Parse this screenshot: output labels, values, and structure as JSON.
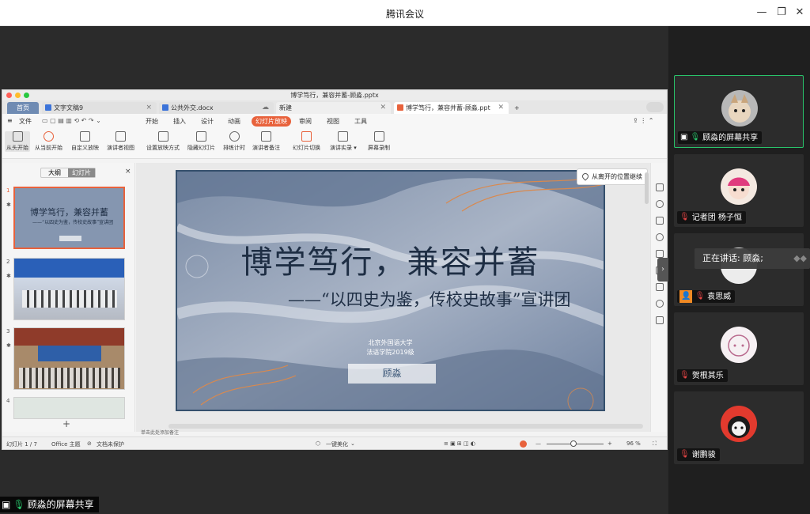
{
  "app": {
    "title": "腾讯会议"
  },
  "shared_window": {
    "doc_title": "博学笃行，兼容并蓄-顾淼.pptx",
    "tabs": [
      {
        "label": "首页"
      },
      {
        "label": "文字文稿9"
      },
      {
        "label": "公共外交.docx"
      },
      {
        "label": "新建"
      },
      {
        "label": "博学笃行，兼容并蓄-顾淼.ppt"
      }
    ],
    "menu": {
      "file": "文件",
      "items": [
        "开始",
        "插入",
        "设计",
        "动画",
        "幻灯片放映",
        "审阅",
        "视图",
        "工具"
      ]
    },
    "ribbon": [
      "从头开始",
      "从当前开始",
      "自定义放映",
      "演讲者视图",
      "设置放映方式",
      "隐藏幻灯片",
      "排练计时",
      "演讲者备注",
      "幻灯片切换",
      "演讲实录",
      "屏幕录制"
    ],
    "outline_tabs": [
      "大纲",
      "幻灯片"
    ],
    "thumb_numbers": [
      "1",
      "2",
      "3",
      "4"
    ],
    "thumb1": {
      "title": "博学笃行，兼容并蓄",
      "subtitle": "——“以四史为鉴，传校史故事”宣讲团"
    },
    "add_slide": "+",
    "slide": {
      "title": "博学笃行，兼容并蓄",
      "subtitle": "——“以四史为鉴，传校史故事”宣讲团",
      "org_line1": "北京外国语大学",
      "org_line2": "法语学院2019级",
      "presenter": "顾淼"
    },
    "resume_button": "从离开的位置继续",
    "notes_placeholder": "单击此处添加备注",
    "status": {
      "slide_counter": "幻灯片 1 / 7",
      "theme": "Office 主题",
      "protect": "文档未保护",
      "beautify": "一键美化",
      "zoom": "96 %"
    }
  },
  "participants": [
    {
      "name": "顾淼的屏幕共享",
      "active": true
    },
    {
      "name": "记者团 杨子恒"
    },
    {
      "name": "袁思威"
    },
    {
      "name": "贺根其乐"
    },
    {
      "name": "谢鹏骏"
    }
  ],
  "speaking": {
    "text": "正在讲话: 顾淼;"
  },
  "share_badge": {
    "text": "顾淼的屏幕共享"
  },
  "colors": {
    "active_border": "#29c36a",
    "accent": "#e8623c",
    "slide_text": "#1e2e44"
  }
}
